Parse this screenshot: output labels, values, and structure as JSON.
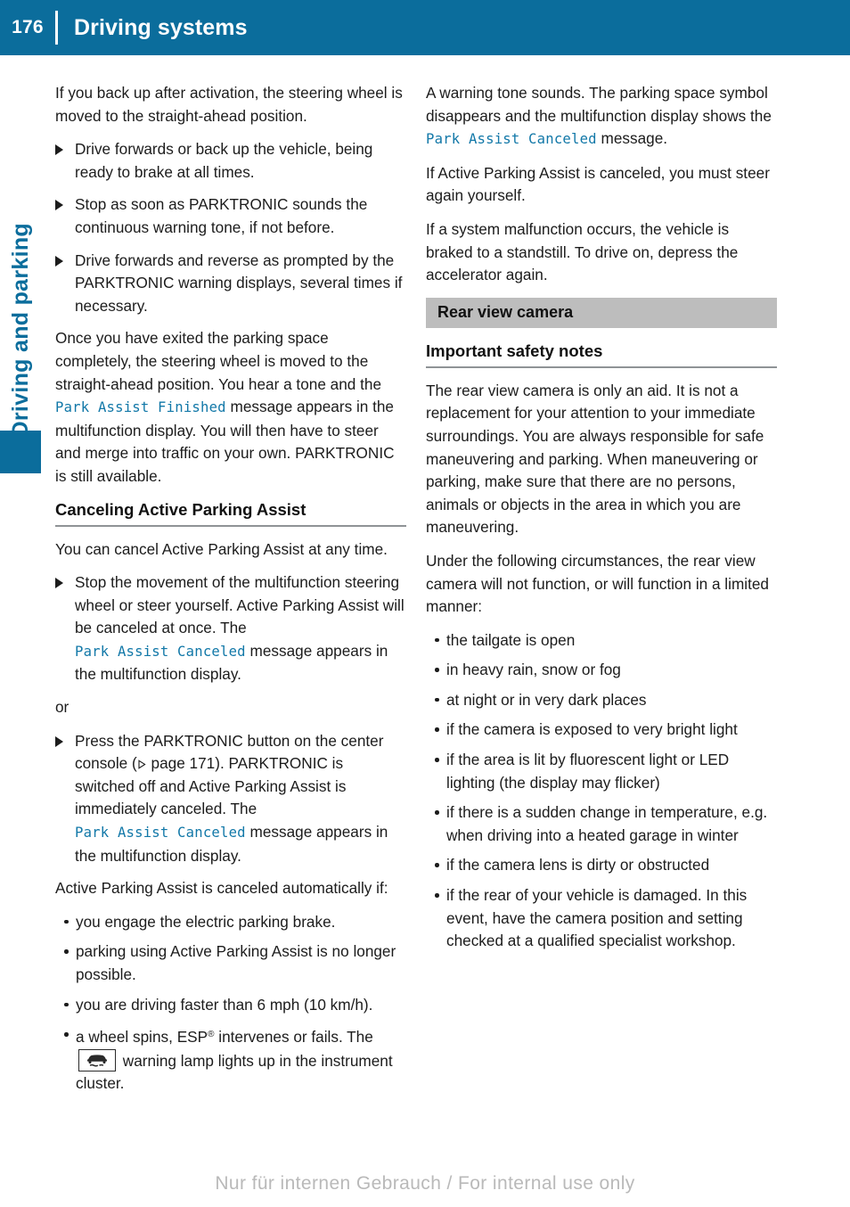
{
  "header": {
    "page_number": "176",
    "title": "Driving systems",
    "bar_color": "#0b6d9c"
  },
  "chapter_tab": {
    "label": "Driving and parking",
    "color": "#0b6d9c"
  },
  "left_column": {
    "intro_paragraph": "If you back up after activation, the steering wheel is moved to the straight-ahead position.",
    "steps": [
      "Drive forwards or back up the vehicle, being ready to brake at all times.",
      "Stop as soon as PARKTRONIC sounds the continuous warning tone, if not before.",
      "Drive forwards and reverse as prompted by the PARKTRONIC warning displays, several times if necessary."
    ],
    "exit_paragraph_part1": "Once you have exited the parking space completely, the steering wheel is moved to the straight-ahead position. You hear a tone and the ",
    "exit_message": "Park Assist Finished",
    "exit_paragraph_part2": " message appears in the multifunction display. You will then have to steer and merge into traffic on your own. PARKTRONIC is still available.",
    "cancel_heading": "Canceling Active Parking Assist",
    "cancel_intro": "You can cancel Active Parking Assist at any time.",
    "step_stop_part1": "Stop the movement of the multifunction steering wheel or steer yourself. Active Parking Assist will be canceled at once. The ",
    "step_stop_message": "Park Assist Canceled",
    "step_stop_part2": " message appears in the multifunction display.",
    "or_label": "or",
    "step_press_part1": "Press the PARKTRONIC button on the center console (",
    "step_press_xref": " page 171",
    "step_press_part2": "). PARKTRONIC is switched off and Active Parking Assist is immediately canceled. The ",
    "step_press_message": "Park Assist Canceled",
    "step_press_part3": " message appears in the multifunction display.",
    "auto_cancel_intro": "Active Parking Assist is canceled automatically if:",
    "auto_cancel_bullets": [
      "you engage the electric parking brake.",
      "parking using Active Parking Assist is no longer possible.",
      "you are driving faster than 6 mph (10 km/h)."
    ],
    "esp_bullet_part1": "a wheel spins, ESP",
    "esp_bullet_registered": "®",
    "esp_bullet_part2": " intervenes or fails. The ",
    "esp_bullet_part3": " warning lamp lights up in the instrument cluster.",
    "esp_lamp_icon": "esp-warning-lamp-icon"
  },
  "right_column": {
    "warning_tone_part1": "A warning tone sounds. The parking space symbol disappears and the multifunction display shows the ",
    "warning_tone_message": "Park Assist Canceled",
    "warning_tone_part2": " message.",
    "canceled_paragraph": "If Active Parking Assist is canceled, you must steer again yourself.",
    "malfunction_paragraph": "If a system malfunction occurs, the vehicle is braked to a standstill. To drive on, depress the accelerator again.",
    "section_title": "Rear view camera",
    "safety_subhead": "Important safety notes",
    "safety_paragraph": "The rear view camera is only an aid. It is not a replacement for your attention to your immediate surroundings. You are always responsible for safe maneuvering and parking. When maneuvering or parking, make sure that there are no persons, animals or objects in the area in which you are maneuvering.",
    "circumstances_intro": "Under the following circumstances, the rear view camera will not function, or will function in a limited manner:",
    "circumstances_bullets": [
      "the tailgate is open",
      "in heavy rain, snow or fog",
      "at night or in very dark places",
      "if the camera is exposed to very bright light",
      "if the area is lit by fluorescent light or LED lighting (the display may flicker)",
      "if there is a sudden change in temperature, e.g. when driving into a heated garage in winter",
      "if the camera lens is dirty or obstructed",
      "if the rear of your vehicle is damaged. In this event, have the camera position and setting checked at a qualified specialist workshop."
    ]
  },
  "footer": {
    "watermark": "Nur für internen Gebrauch / For internal use only"
  }
}
